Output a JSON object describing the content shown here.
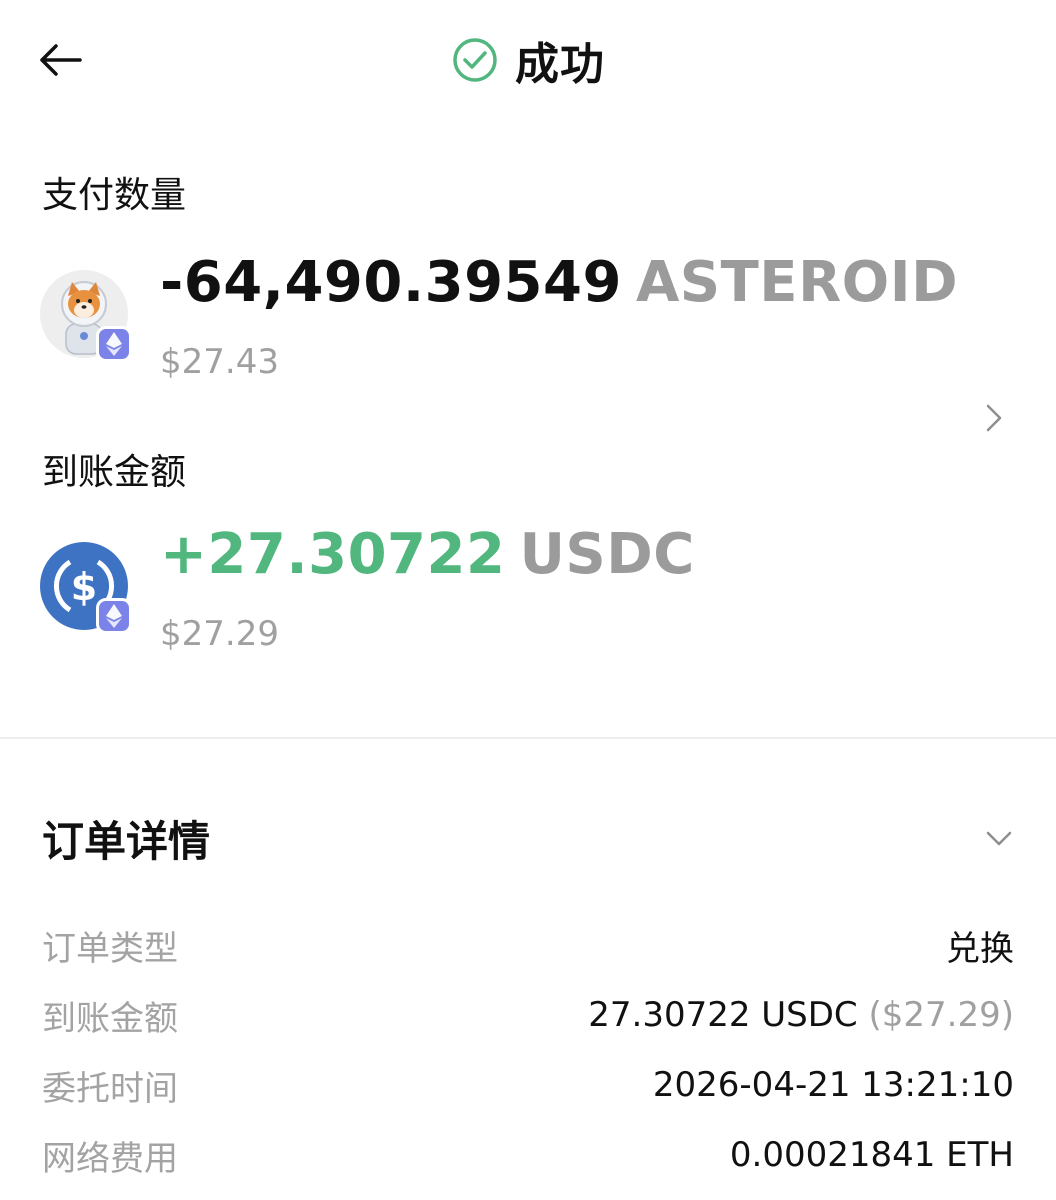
{
  "header": {
    "title": "成功",
    "status_color": "#52b77e"
  },
  "pay": {
    "label": "支付数量",
    "amount": "-64,490.39549",
    "symbol": "ASTEROID",
    "usd_value": "$27.43",
    "token_icon": "shiba-astronaut-token-icon",
    "chain_icon": "ethereum-icon"
  },
  "receive": {
    "label": "到账金额",
    "amount": "+27.30722",
    "symbol": "USDC",
    "usd_value": "$27.29",
    "token_icon": "usdc-token-icon",
    "chain_icon": "ethereum-icon",
    "amount_color": "#52b77e"
  },
  "order_details": {
    "title": "订单详情",
    "rows": [
      {
        "label": "订单类型",
        "value": "兑换",
        "extra": ""
      },
      {
        "label": "到账金额",
        "value": "27.30722 USDC",
        "extra": "($27.29)"
      },
      {
        "label": "委托时间",
        "value": "2026-04-21 13:21:10",
        "extra": ""
      },
      {
        "label": "网络费用",
        "value": "0.00021841 ETH",
        "extra": ""
      }
    ]
  }
}
